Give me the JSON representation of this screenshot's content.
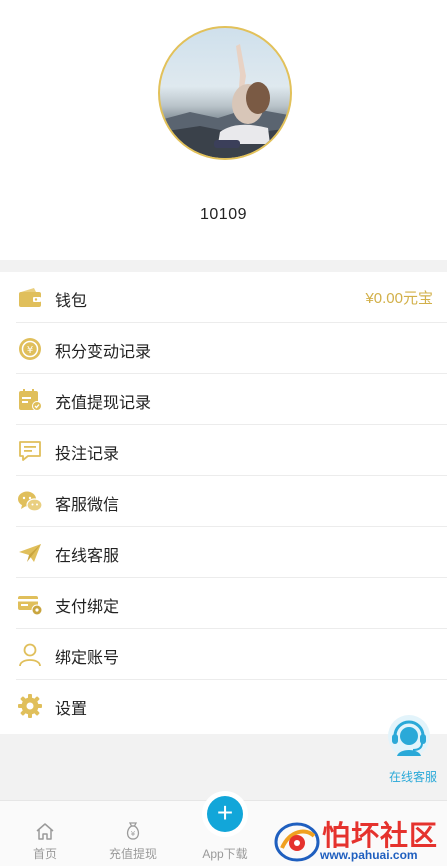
{
  "profile": {
    "username": "10109"
  },
  "menu": {
    "items": [
      {
        "label": "钱包",
        "value": "¥0.00元宝",
        "icon": "wallet-icon"
      },
      {
        "label": "积分变动记录",
        "icon": "points-coin-icon"
      },
      {
        "label": "充值提现记录",
        "icon": "calendar-record-icon"
      },
      {
        "label": "投注记录",
        "icon": "message-record-icon"
      },
      {
        "label": "客服微信",
        "icon": "wechat-icon"
      },
      {
        "label": "在线客服",
        "icon": "paper-plane-icon"
      },
      {
        "label": "支付绑定",
        "icon": "card-gear-icon"
      },
      {
        "label": "绑定账号",
        "icon": "user-icon"
      },
      {
        "label": "设置",
        "icon": "gear-icon"
      }
    ]
  },
  "float_service": {
    "label": "在线客服",
    "icon": "headset-agent-icon"
  },
  "tabbar": {
    "tabs": [
      {
        "label": "首页",
        "icon": "home-icon"
      },
      {
        "label": "充值提现",
        "icon": "money-bag-icon"
      },
      {
        "label": "App下载",
        "icon": "plus-circle-icon"
      }
    ]
  },
  "watermark": {
    "title": "怕坏社区",
    "url": "www.pahuai.com"
  },
  "colors": {
    "accent_gold": "#d2b049",
    "icon_gold": "#e0bf5b",
    "service_blue": "#2aa9d8",
    "download_blue": "#12a6d9",
    "watermark_red": "#e5322d",
    "watermark_blue": "#1f5fbf"
  }
}
